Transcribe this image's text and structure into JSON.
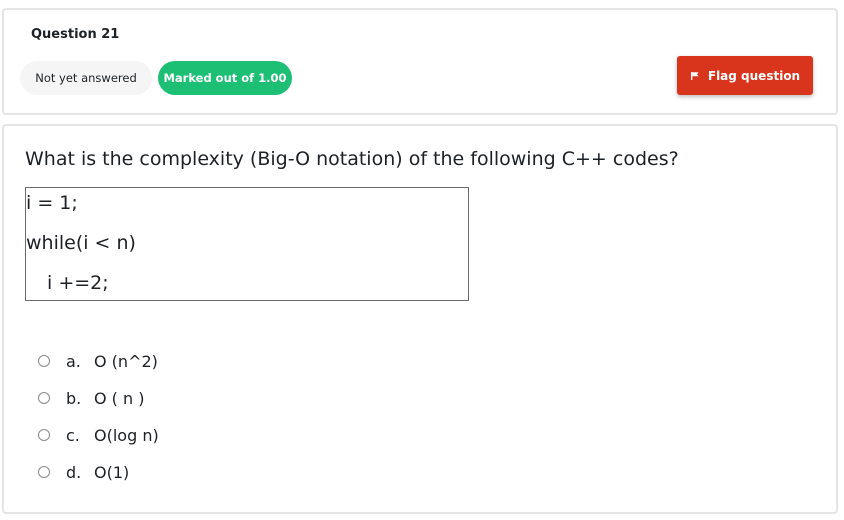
{
  "question_info": {
    "title": "Question 21",
    "state": "Not yet answered",
    "marks": "Marked out of 1.00",
    "flag_label": "Flag question"
  },
  "question": {
    "text": "What is the complexity (Big-O notation) of the following C++ codes?",
    "code_lines": [
      "i = 1;",
      "while(i < n)",
      "i +=2;"
    ],
    "options": [
      {
        "letter": "a.",
        "text": "O (n^2)"
      },
      {
        "letter": "b.",
        "text": "O ( n )"
      },
      {
        "letter": "c.",
        "text": "O(log n)"
      },
      {
        "letter": "d.",
        "text": "O(1)"
      }
    ]
  },
  "colors": {
    "marks_badge": "#1cbf73",
    "flag_button": "#d9341c",
    "state_badge": "#f5f5f5"
  },
  "icons": {
    "flag": "flag-icon",
    "radio": "radio-icon"
  }
}
